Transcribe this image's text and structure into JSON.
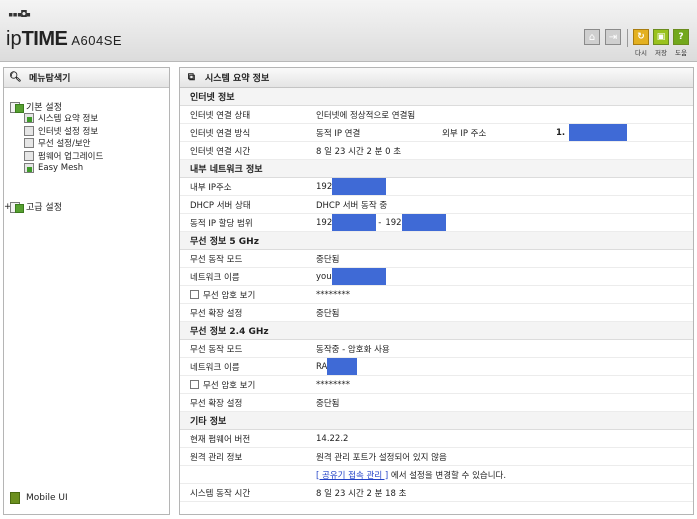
{
  "header": {
    "brand_ip": "ip",
    "brand_time": "TIME",
    "model": "A604SE",
    "buttons": [
      {
        "label": "다시",
        "color": "#e3b020"
      },
      {
        "label": "저장",
        "color": "#9ac21e"
      },
      {
        "label": "도움",
        "color": "#72a81c"
      }
    ]
  },
  "sidebar": {
    "title": "메뉴탐색기",
    "groups": [
      {
        "label": "기본 설정",
        "items": [
          "시스템 요약 정보",
          "인터넷 설정 정보",
          "무선 설정/보안",
          "펌웨어 업그레이드",
          "Easy Mesh"
        ]
      },
      {
        "label": "고급 설정",
        "items": []
      }
    ],
    "mobile_ui": "Mobile UI"
  },
  "main": {
    "title": "시스템 요약 정보",
    "internet": {
      "title": "인터넷 정보",
      "status_label": "인터넷 연결 상태",
      "status_value": "인터넷에 정상적으로 연결됨",
      "method_label": "인터넷 연결 방식",
      "method_value": "동적 IP 연결",
      "ext_ip_label": "외부 IP 주소",
      "ext_ip_prefix": "1.",
      "time_label": "인터넷 연결 시간",
      "time_value": "8 일 23 시간 2 분 0 초"
    },
    "internal": {
      "title": "내부 네트워크 정보",
      "ip_label": "내부 IP주소",
      "ip_prefix": "192",
      "dhcp_label": "DHCP 서버 상태",
      "dhcp_value": "DHCP 서버 동작 중",
      "range_label": "동적 IP 할당 범위",
      "range_start_prefix": "192",
      "range_sep": "-",
      "range_end_prefix": "192"
    },
    "wifi5": {
      "title": "무선 정보 5 GHz",
      "mode_label": "무선 동작 모드",
      "mode_value": "중단됨",
      "ssid_label": "네트워크 이름",
      "ssid_prefix": "you",
      "pw_label": "무선 암호 보기",
      "pw_value": "********",
      "ext_label": "무선 확장 설정",
      "ext_value": "중단됨"
    },
    "wifi24": {
      "title": "무선 정보 2.4 GHz",
      "mode_label": "무선 동작 모드",
      "mode_value": "동작중 - 암호화 사용",
      "ssid_label": "네트워크 이름",
      "ssid_prefix": "RA",
      "pw_label": "무선 암호 보기",
      "pw_value": "********",
      "ext_label": "무선 확장 설정",
      "ext_value": "중단됨"
    },
    "other": {
      "title": "기타 정보",
      "fw_label": "현재 펌웨어 버전",
      "fw_value": "14.22.2",
      "remote_label": "원격 관리 정보",
      "remote_value": "원격 관리 포트가 설정되어 있지 않음",
      "remote_link": "[ 공유기 접속 관리 ]",
      "remote_link_suffix": " 에서 설정을 변경할 수 있습니다.",
      "uptime_label": "시스템 동작 시간",
      "uptime_value": "8 일 23 시간 2 분 18 초"
    }
  }
}
